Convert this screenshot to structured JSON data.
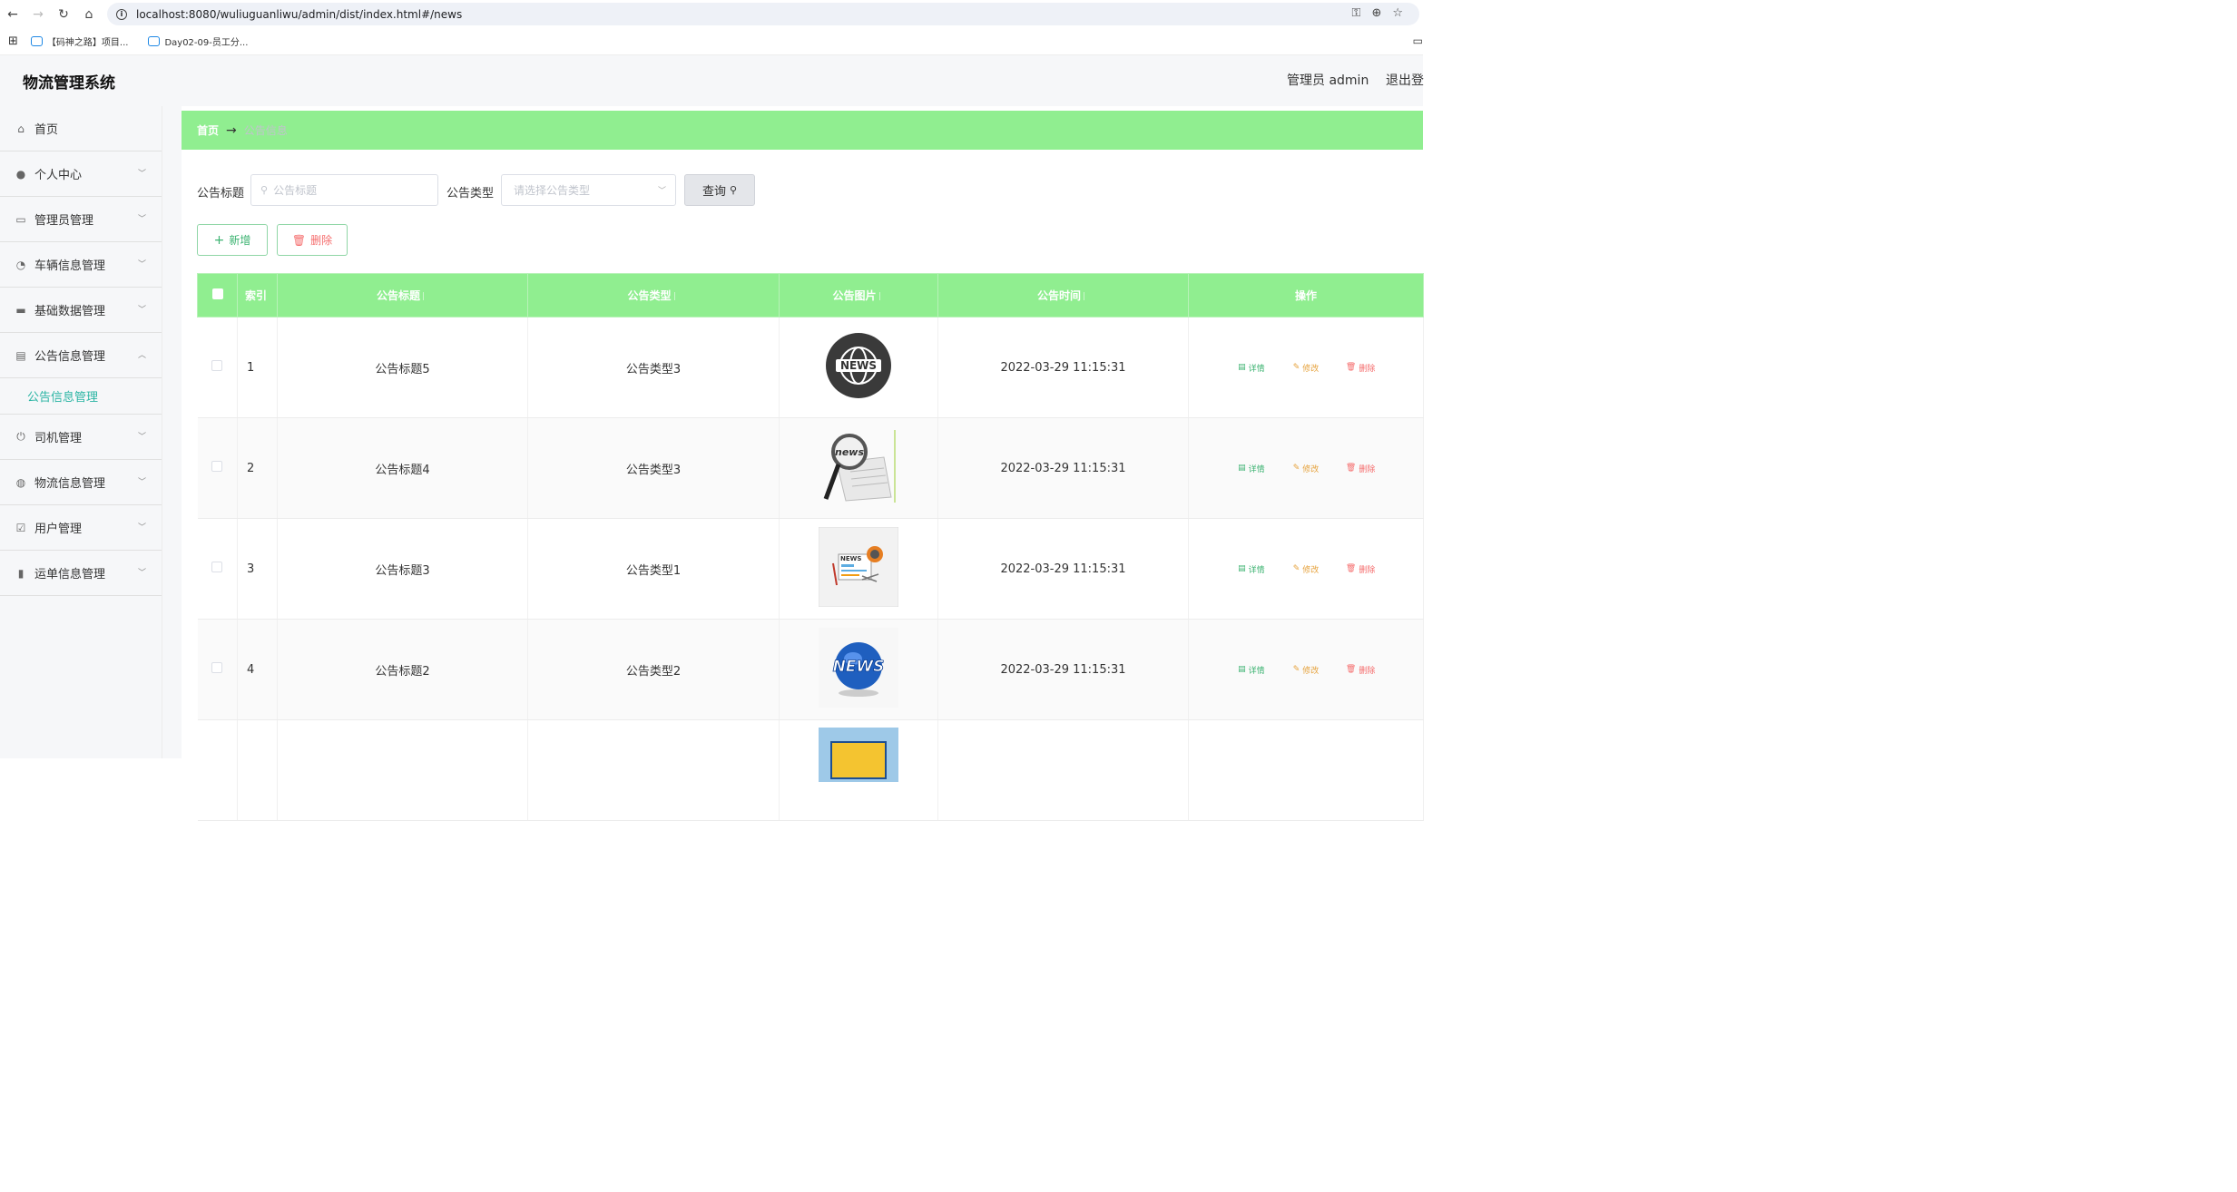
{
  "browser": {
    "url": "localhost:8080/wuliuguanliwu/admin/dist/index.html#/news",
    "bookmarks": [
      "【码神之路】项目...",
      "Day02-09-员工分..."
    ]
  },
  "header": {
    "title": "物流管理系统",
    "user": "管理员 admin",
    "logout": "退出登"
  },
  "sidebar": {
    "items": [
      {
        "label": "首页",
        "icon": "home-icon"
      },
      {
        "label": "个人中心",
        "icon": "user-icon"
      },
      {
        "label": "管理员管理",
        "icon": "chat-icon"
      },
      {
        "label": "车辆信息管理",
        "icon": "gauge-icon"
      },
      {
        "label": "基础数据管理",
        "icon": "message-icon"
      },
      {
        "label": "公告信息管理",
        "icon": "clipboard-icon"
      },
      {
        "label": "司机管理",
        "icon": "power-icon"
      },
      {
        "label": "物流信息管理",
        "icon": "globe-icon"
      },
      {
        "label": "用户管理",
        "icon": "checklist-icon"
      },
      {
        "label": "运单信息管理",
        "icon": "bar-chart-icon"
      }
    ],
    "submenu_active": "公告信息管理"
  },
  "breadcrumb": {
    "home": "首页",
    "current": "公告信息"
  },
  "search": {
    "title_label": "公告标题",
    "title_placeholder": "公告标题",
    "type_label": "公告类型",
    "type_placeholder": "请选择公告类型",
    "query_button": "查询"
  },
  "actions": {
    "add": "新增",
    "delete": "删除"
  },
  "table": {
    "columns": [
      "索引",
      "公告标题",
      "公告类型",
      "公告图片",
      "公告时间",
      "操作"
    ],
    "ops": {
      "detail": "详情",
      "edit": "修改",
      "delete": "删除"
    },
    "rows": [
      {
        "index": "1",
        "title": "公告标题5",
        "type": "公告类型3",
        "image": "news-globe-badge",
        "time": "2022-03-29 11:15:31"
      },
      {
        "index": "2",
        "title": "公告标题4",
        "type": "公告类型3",
        "image": "news-magnifier",
        "time": "2022-03-29 11:15:31"
      },
      {
        "index": "3",
        "title": "公告标题3",
        "type": "公告类型1",
        "image": "news-paper-illustration",
        "time": "2022-03-29 11:15:31"
      },
      {
        "index": "4",
        "title": "公告标题2",
        "type": "公告类型2",
        "image": "news-3d-globe",
        "time": "2022-03-29 11:15:31"
      }
    ]
  }
}
